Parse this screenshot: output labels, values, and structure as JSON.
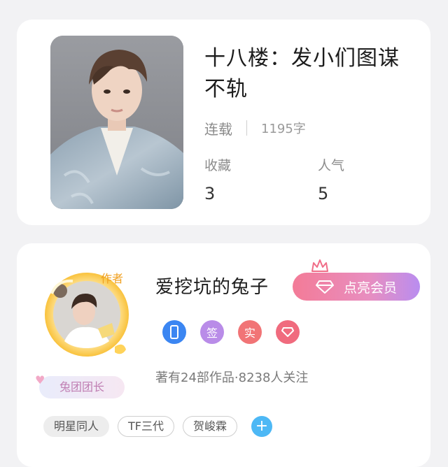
{
  "book": {
    "title": "十八楼：发小们图谋不轨",
    "status": "连载",
    "word_count": "1195字",
    "favorites_label": "收藏",
    "favorites_value": "3",
    "popularity_label": "人气",
    "popularity_value": "5"
  },
  "author": {
    "name": "爱挖坑的兔子",
    "avatar_badge": "作者",
    "rank_badge": "兔团团长",
    "vip_button": "点亮会员",
    "badges": [
      {
        "text": "▯",
        "name": "phone-badge"
      },
      {
        "text": "签",
        "name": "signed-badge"
      },
      {
        "text": "实",
        "name": "verified-badge"
      },
      {
        "text": "",
        "name": "diamond-badge"
      }
    ],
    "meta": "著有24部作品·8238人关注",
    "tags": [
      "明星同人",
      "TF三代",
      "贺峻霖"
    ],
    "add_tag": "+"
  },
  "colors": {
    "accent_pink": "#f37b97",
    "accent_purple": "#b98df0",
    "badge_blue": "#3b86f2",
    "add_blue": "#4db8f5"
  }
}
